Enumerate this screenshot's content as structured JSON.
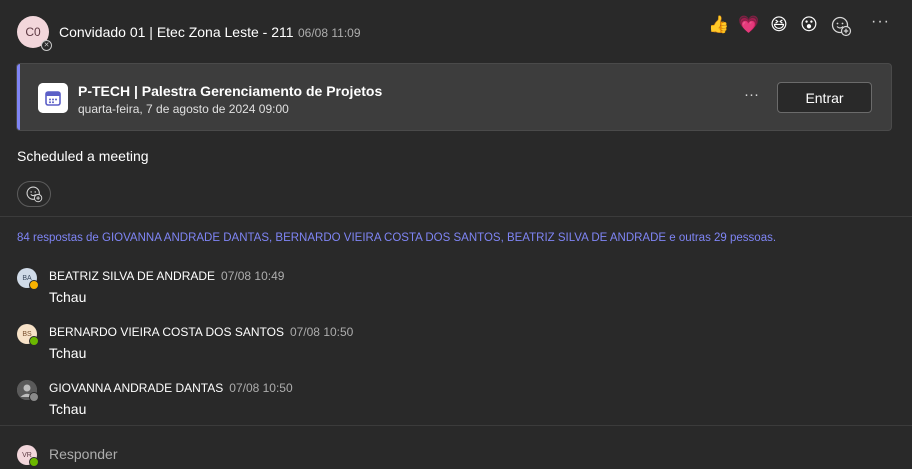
{
  "post": {
    "avatar_initials": "C0",
    "sender": "Convidado 01 | Etec Zona Leste - 211",
    "timestamp": "06/08 11:09",
    "reactions": [
      {
        "name": "like-reaction",
        "glyph": "👍"
      },
      {
        "name": "heart-reaction",
        "glyph": "💗"
      },
      {
        "name": "laugh-reaction",
        "glyph": "😆"
      },
      {
        "name": "surprised-reaction",
        "glyph": "😮"
      }
    ],
    "more_label": "···"
  },
  "meeting": {
    "title": "P-TECH | Palestra Gerenciamento de Projetos",
    "when": "quarta-feira, 7 de agosto de 2024 09:00",
    "more_label": "···",
    "join_label": "Entrar"
  },
  "message_text": "Scheduled a meeting",
  "replies_summary": "84 respostas de GIOVANNA ANDRADE DANTAS, BERNARDO VIEIRA COSTA DOS SANTOS, BEATRIZ SILVA DE ANDRADE e outras 29 pessoas.",
  "replies": [
    {
      "initials": "BA",
      "name": "BEATRIZ SILVA DE ANDRADE",
      "time": "07/08 10:49",
      "text": "Tchau",
      "avatar_bg": "#d0dbe8",
      "avatar_fg": "#3a4a5e",
      "presence": "#f8b200"
    },
    {
      "initials": "BS",
      "name": "BERNARDO VIEIRA COSTA DOS SANTOS",
      "time": "07/08 10:50",
      "text": "Tchau",
      "avatar_bg": "#f7e2c8",
      "avatar_fg": "#7a5230",
      "presence": "#6bb700"
    },
    {
      "initials": "",
      "name": "GIOVANNA ANDRADE DANTAS",
      "time": "07/08 10:50",
      "text": "Tchau",
      "avatar_bg": "#6e6e6e",
      "avatar_fg": "#ffffff",
      "presence": "#8a8a8a"
    }
  ],
  "reply_box": {
    "avatar_initials": "VR",
    "placeholder": "Responder"
  },
  "colors": {
    "background": "#292929",
    "card": "#3d3d3d",
    "accent": "#7f85f5",
    "available": "#6bb700",
    "away": "#f8b200"
  }
}
